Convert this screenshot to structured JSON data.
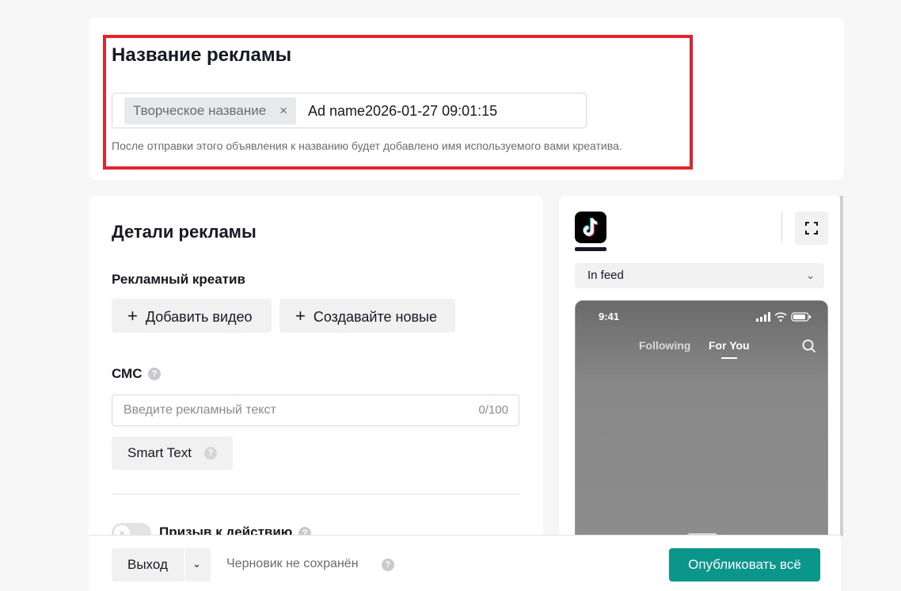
{
  "ad_name": {
    "title": "Название рекламы",
    "chip_label": "Творческое название",
    "chip_remove": "×",
    "value": "Ad name2026-01-27 09:01:15",
    "hint": "После отправки этого объявления к названию будет добавлено имя используемого вами креатива."
  },
  "details": {
    "title": "Детали рекламы",
    "creative_label": "Рекламный креатив",
    "add_video": "Добавить видео",
    "create_new": "Создавайте новые",
    "plus": "+",
    "sms_label": "СМС",
    "sms_placeholder": "Введите рекламный текст",
    "sms_counter": "0/100",
    "smart_text": "Smart Text",
    "cta_label": "Призыв к действию",
    "help": "?"
  },
  "preview": {
    "placement": "In feed",
    "chevron": "⌄",
    "phone_time": "9:41",
    "tab_following": "Following",
    "tab_for_you": "For You",
    "icons": [
      "tiktok-logo",
      "fullscreen-icon",
      "signal-icon",
      "wifi-icon",
      "battery-icon",
      "search-icon"
    ]
  },
  "footer": {
    "exit": "Выход",
    "exit_chevron": "⌄",
    "draft_status": "Черновик не сохранён",
    "publish": "Опубликовать всё"
  },
  "colors": {
    "accent": "#0a968b",
    "highlight": "#e0252e"
  }
}
